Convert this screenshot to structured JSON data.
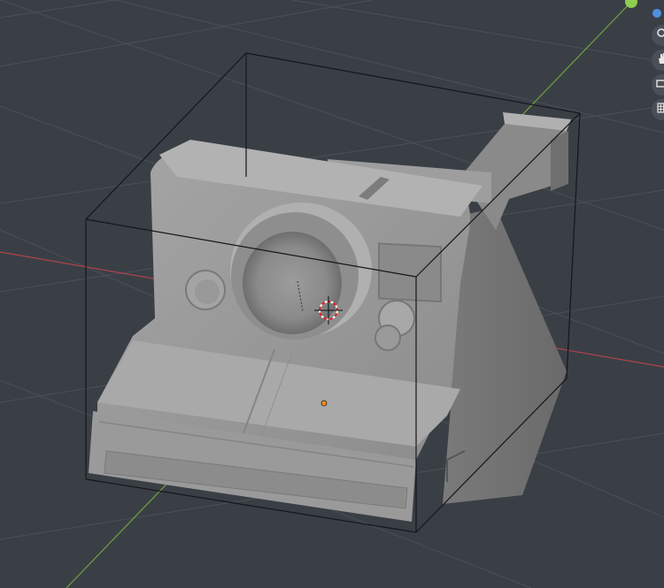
{
  "viewport": {
    "background": "#3a3f46",
    "grid_color": "#4b5058",
    "x_axis_color": "#b4424c",
    "y_axis_color": "#6fa240"
  },
  "object": {
    "name": "instant camera",
    "base_color": "#9a9a9a",
    "bounding_box_color": "#14161a",
    "origin_color": "#f08a24"
  },
  "gizmo": {
    "buttons": [
      {
        "icon": "zoom-icon"
      },
      {
        "icon": "hand-icon"
      },
      {
        "icon": "camera-view-icon"
      },
      {
        "icon": "perspective-grid-icon"
      }
    ],
    "y_axis_dot_color": "#8fcf4f",
    "z_axis_dot_color": "#4f8fe0"
  }
}
